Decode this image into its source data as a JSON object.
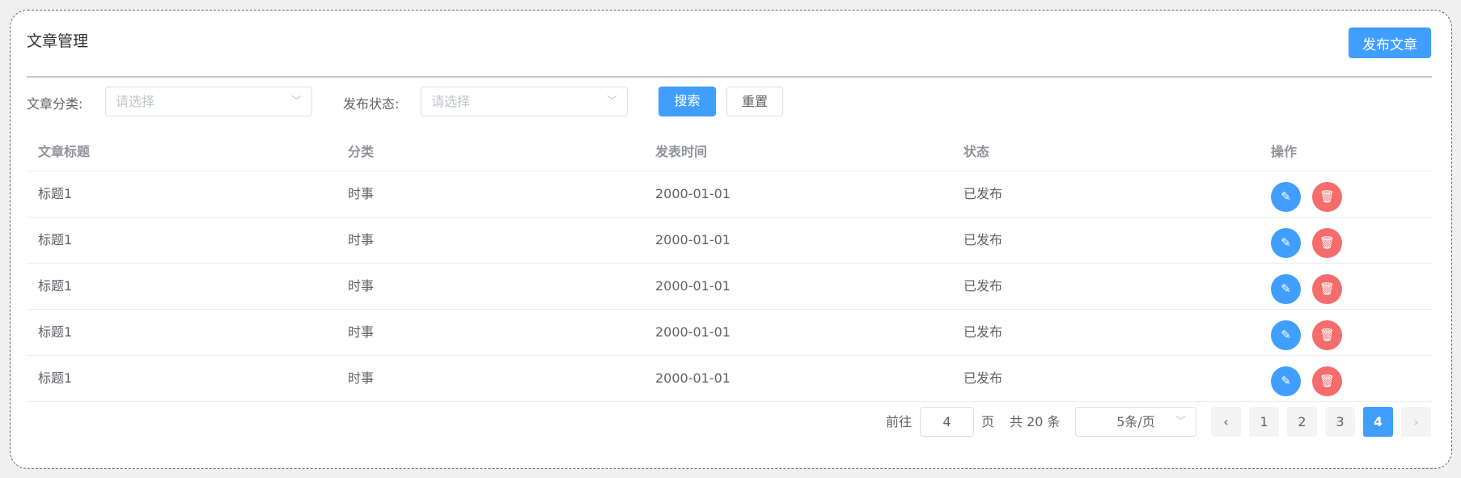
{
  "header": {
    "title": "文章管理",
    "publish_label": "发布文章"
  },
  "filters": {
    "category_label": "文章分类:",
    "category_placeholder": "请选择",
    "status_label": "发布状态:",
    "status_placeholder": "请选择",
    "search_label": "搜索",
    "reset_label": "重置"
  },
  "table": {
    "columns": [
      "文章标题",
      "分类",
      "发表时间",
      "状态",
      "操作"
    ],
    "rows": [
      {
        "title": "标题1",
        "category": "时事",
        "date": "2000-01-01",
        "status": "已发布"
      },
      {
        "title": "标题1",
        "category": "时事",
        "date": "2000-01-01",
        "status": "已发布"
      },
      {
        "title": "标题1",
        "category": "时事",
        "date": "2000-01-01",
        "status": "已发布"
      },
      {
        "title": "标题1",
        "category": "时事",
        "date": "2000-01-01",
        "status": "已发布"
      },
      {
        "title": "标题1",
        "category": "时事",
        "date": "2000-01-01",
        "status": "已发布"
      }
    ]
  },
  "pagination": {
    "goto_label": "前往",
    "goto_value": "4",
    "page_suffix": "页",
    "total_text": "共 20 条",
    "page_size": "5条/页",
    "pages": [
      "1",
      "2",
      "3",
      "4"
    ],
    "current": "4"
  },
  "colors": {
    "primary": "#409eff",
    "danger": "#f56c6c"
  }
}
